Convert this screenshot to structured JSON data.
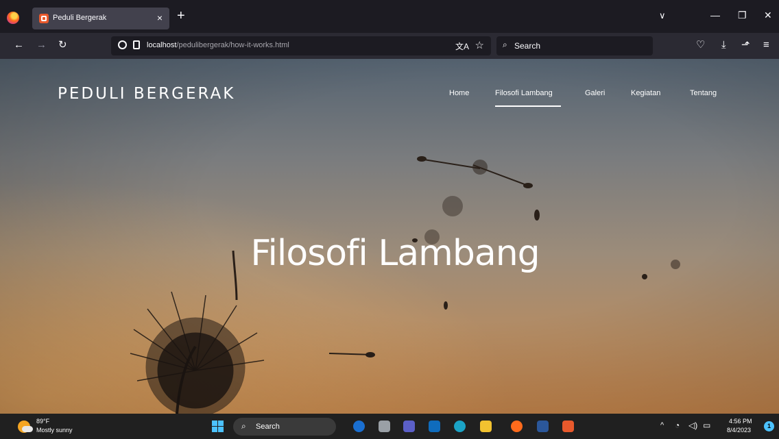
{
  "browser": {
    "tab_title": "Peduli Bergerak",
    "tab_close": "×",
    "new_tab": "+",
    "list_tabs": "∨",
    "window": {
      "minimize": "—",
      "maximize": "❐",
      "close": "✕"
    },
    "nav": {
      "back": "←",
      "forward": "→",
      "reload": "↻"
    },
    "url_host": "localhost",
    "url_path": "/pedulibergerak/how-it-works.html",
    "search_placeholder": "Search",
    "toolbar": {
      "pocket": "♡",
      "downloads": "⤓",
      "extensions": "⬏",
      "menu": "≡"
    }
  },
  "site": {
    "brand": "PEDULI BERGERAK",
    "nav": [
      {
        "label": "Home"
      },
      {
        "label": "Filosofi Lambang",
        "active": true
      },
      {
        "label": "Galeri"
      },
      {
        "label": "Kegiatan"
      },
      {
        "label": "Tentang"
      }
    ],
    "hero_title": "Filosofi Lambang"
  },
  "taskbar": {
    "weather_temp": "89°F",
    "weather_condition": "Mostly sunny",
    "search_label": "Search",
    "apps": [
      "bing",
      "task-view",
      "teams",
      "mail",
      "edge",
      "file-explorer",
      "firefox",
      "word",
      "xampp"
    ],
    "time": "4:56 PM",
    "date": "8/4/2023",
    "notifications": "1"
  },
  "colors": {
    "browser_chrome": "#1c1b22",
    "toolbar": "#2b2a33",
    "taskbar": "#202020",
    "accent": "#4cc2ff"
  }
}
